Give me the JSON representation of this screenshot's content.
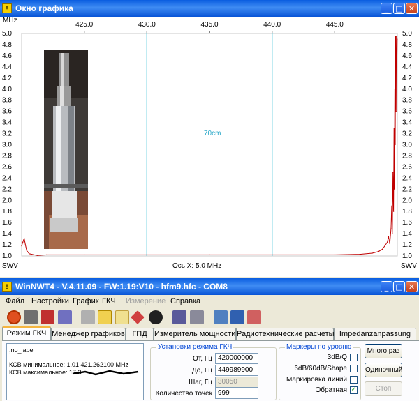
{
  "graph_window": {
    "title": "Окно графика",
    "unit_label": "MHz",
    "marker_label": "70cm",
    "x_axis_label": "Ось X: 5.0 MHz",
    "left_axis_name": "SWV",
    "right_axis_name": "SWV"
  },
  "chart_data": {
    "type": "line",
    "x_ticks": [
      "425.0",
      "430.0",
      "435.0",
      "440.0",
      "445.0"
    ],
    "y_ticks": [
      "5.0",
      "4.8",
      "4.6",
      "4.4",
      "4.2",
      "4.0",
      "3.8",
      "3.6",
      "3.4",
      "3.2",
      "3.0",
      "2.8",
      "2.6",
      "2.4",
      "2.2",
      "2.0",
      "1.8",
      "1.6",
      "1.4",
      "1.2",
      "1.0"
    ],
    "xlim": [
      420.0,
      450.0
    ],
    "ylim": [
      1.0,
      5.0
    ],
    "band_markers_mhz": [
      430.0,
      440.0
    ],
    "series": [
      {
        "color": "#c00000",
        "x": [
          420.0,
          420.1,
          420.2,
          420.3,
          420.4,
          420.6,
          421.0,
          421.26,
          422,
          425,
          430,
          435,
          440,
          445,
          447,
          448,
          448.5,
          448.8,
          449.0,
          449.2,
          449.3,
          449.4,
          449.5,
          449.55,
          449.6,
          449.65,
          449.7,
          449.73,
          449.76,
          449.8,
          449.83,
          449.86,
          449.9,
          449.93,
          449.96,
          449.99
        ],
        "values": [
          1.18,
          1.25,
          1.32,
          1.2,
          1.1,
          1.04,
          1.02,
          1.01,
          1.02,
          1.02,
          1.02,
          1.02,
          1.02,
          1.02,
          1.03,
          1.05,
          1.08,
          1.12,
          1.18,
          1.25,
          1.35,
          1.22,
          1.5,
          1.9,
          1.4,
          2.5,
          1.8,
          3.3,
          2.2,
          4.0,
          3.0,
          4.95,
          3.6,
          4.95,
          4.4,
          4.9
        ]
      }
    ]
  },
  "main_window": {
    "title": "WinNWT4 - V.4.11.09 - FW:1.19:V10 - hfm9.hfc - COM8",
    "menu": [
      "Файл",
      "Настройки",
      "График",
      "ГКЧ",
      "Измерение",
      "Справка"
    ],
    "tabs": [
      "Режим ГКЧ",
      "Менеджер графиков",
      "ГПД",
      "Измеритель мощности",
      "Радиотехнические расчеты",
      "Impedanzanpassung"
    ],
    "memo": {
      "line1": ";no_label",
      "line2": "КСВ минимальное: 1.01  421.262100 MHz",
      "line3": "КСВ максимальное: 17.3"
    },
    "settings": {
      "title": "Установки режима ГКЧ",
      "from_label": "От, Гц",
      "from_value": "420000000",
      "to_label": "До, Гц",
      "to_value": "449989900",
      "step_label": "Шаг, Гц",
      "step_value": "30050",
      "points_label": "Количество точек",
      "points_value": "999"
    },
    "markers": {
      "title": "Маркеры по уровню",
      "opt1": "3dB/Q",
      "opt2": "6dB/60dB/Shape",
      "opt3": "Маркировка линий",
      "opt4": "Обратная"
    },
    "buttons": {
      "multi": "Много раз",
      "single": "Одиночный",
      "stop": "Стоп"
    }
  }
}
